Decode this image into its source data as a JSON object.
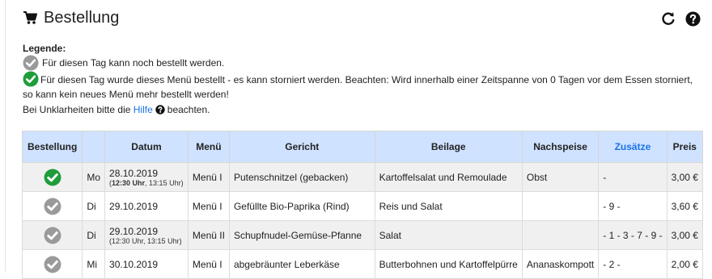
{
  "header": {
    "title": "Bestellung",
    "icon": "shopping-cart-icon"
  },
  "toolbar": {
    "refresh_icon": "refresh-icon",
    "help_icon": "question-circle-icon"
  },
  "colors": {
    "ordered": "#1f9d3a",
    "open": "#9a9a9a",
    "header_bg": "#cfe2ff",
    "link": "#1a73e8"
  },
  "legend": {
    "title": "Legende:",
    "open_text": "Für diesen Tag kann noch bestellt werden.",
    "ordered_text": "Für diesen Tag wurde dieses Menü bestellt - es kann storniert werden. Beachten: Wird innerhalb einer Zeitspanne von 0 Tagen vor dem Essen storniert, so kann kein neues Menü mehr bestellt werden!",
    "help_prefix": "Bei Unklarheiten bitte die",
    "help_link": "Hilfe",
    "help_suffix": "beachten."
  },
  "table": {
    "headers": {
      "bestellung": "Bestellung",
      "datum": "Datum",
      "menu": "Menü",
      "gericht": "Gericht",
      "beilage": "Beilage",
      "nachspeise": "Nachspeise",
      "zusaetze": "Zusätze",
      "preis": "Preis"
    },
    "rows": [
      {
        "status": "ordered",
        "day": "Mo",
        "date": "28.10.2019",
        "time_bold": "12:30 Uhr",
        "time_rest": ", 13:15 Uhr)",
        "menu": "Menü I",
        "gericht": "Putenschnitzel (gebacken)",
        "beilage": "Kartoffelsalat und Remoulade",
        "nachspeise": "Obst",
        "zusaetze": "-",
        "preis": "3,00 €"
      },
      {
        "status": "open",
        "day": "Di",
        "date": "29.10.2019",
        "time_bold": "",
        "time_rest": "",
        "menu": "Menü I",
        "gericht": "Gefüllte Bio-Paprika (Rind)",
        "beilage": "Reis und Salat",
        "nachspeise": "",
        "zusaetze": "- 9 -",
        "preis": "3,60 €"
      },
      {
        "status": "open",
        "day": "Di",
        "date": "29.10.2019",
        "time_bold": "",
        "time_rest": "(12:30 Uhr, 13:15 Uhr)",
        "menu": "Menü II",
        "gericht": "Schupfnudel-Gemüse-Pfanne",
        "beilage": "Salat",
        "nachspeise": "",
        "zusaetze": "- 1 - 3 - 7 - 9 -",
        "preis": "3,00 €"
      },
      {
        "status": "open",
        "day": "Mi",
        "date": "30.10.2019",
        "time_bold": "",
        "time_rest": "",
        "menu": "Menü I",
        "gericht": "abgebräunter Leberkäse",
        "beilage": "Butterbohnen und Kartoffelpürre",
        "nachspeise": "Ananaskompott",
        "zusaetze": "- 2 -",
        "preis": "2,00 €"
      }
    ]
  }
}
